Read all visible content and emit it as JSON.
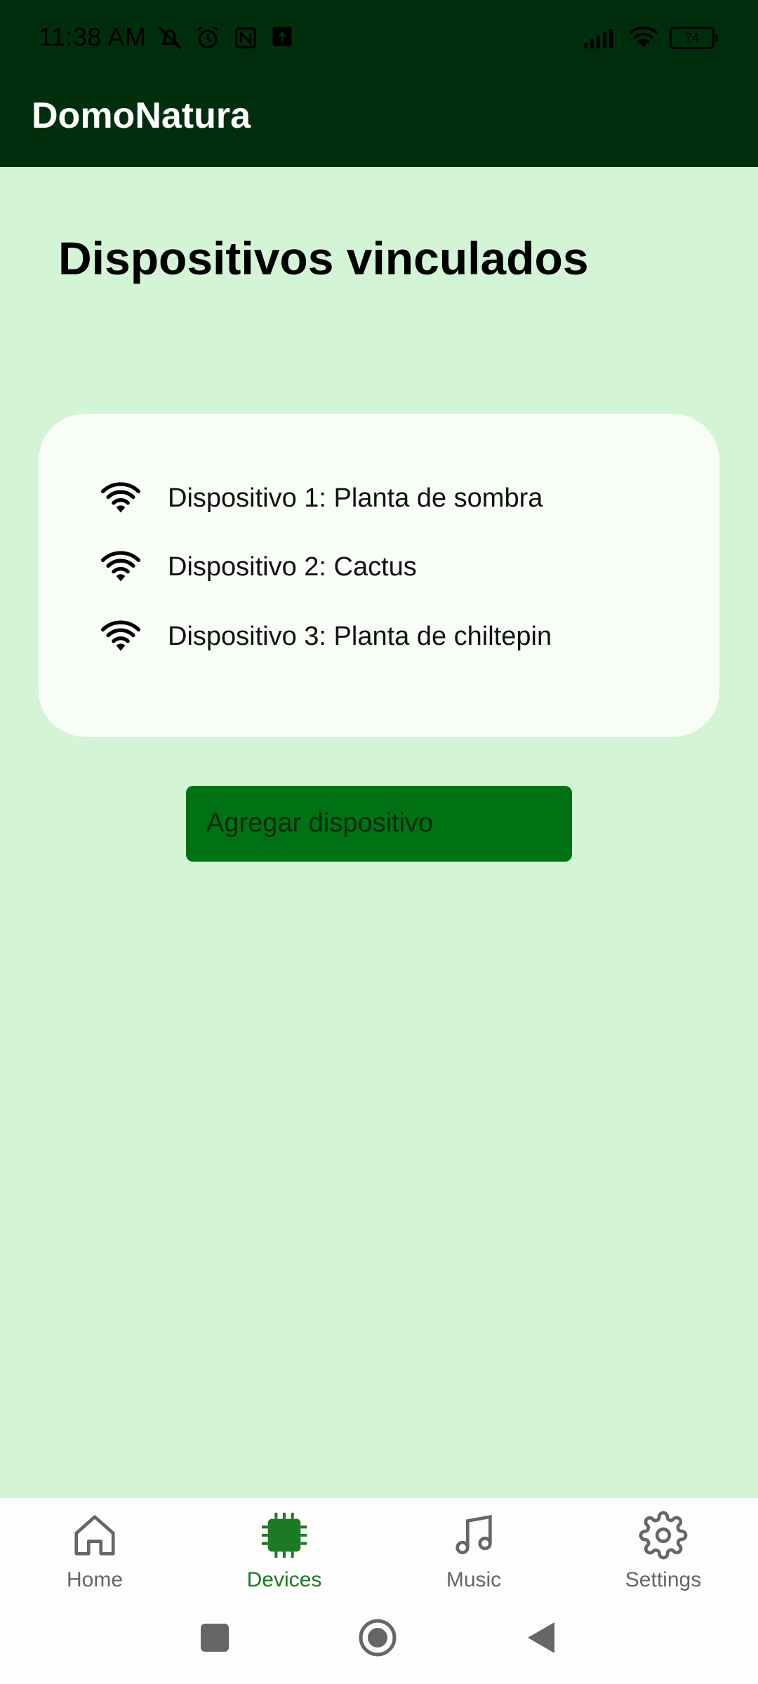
{
  "status_bar": {
    "time": "11:38 AM",
    "battery": "74"
  },
  "app_bar": {
    "title": "DomoNatura"
  },
  "page": {
    "title": "Dispositivos vinculados"
  },
  "devices": [
    {
      "label": "Dispositivo 1: Planta de sombra",
      "icon": "wifi-icon"
    },
    {
      "label": "Dispositivo 2: Cactus",
      "icon": "wifi-icon"
    },
    {
      "label": "Dispositivo 3: Planta de chiltepin",
      "icon": "wifi-icon"
    }
  ],
  "add_button": {
    "label": "Agregar dispositivo"
  },
  "bottom_nav": {
    "items": [
      {
        "label": "Home",
        "icon": "home-icon",
        "active": false
      },
      {
        "label": "Devices",
        "icon": "chip-icon",
        "active": true
      },
      {
        "label": "Music",
        "icon": "music-note-icon",
        "active": false
      },
      {
        "label": "Settings",
        "icon": "gear-icon",
        "active": false
      }
    ]
  },
  "colors": {
    "header_bg": "#002e0c",
    "page_bg": "#d4f4d6",
    "card_bg": "#f9fdf8",
    "button_bg": "#007213",
    "active_nav": "#1c7a24"
  }
}
